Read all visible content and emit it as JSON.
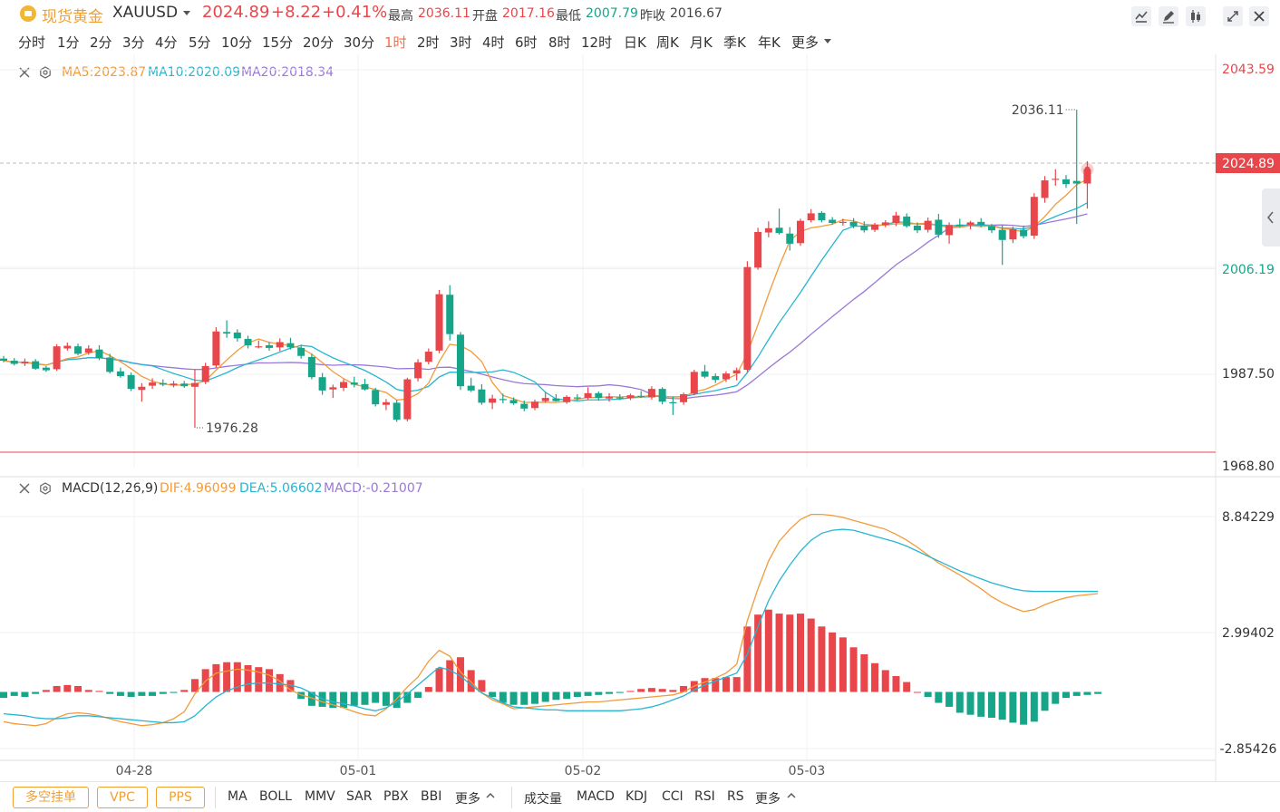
{
  "header": {
    "symbol_name": "现货黄金",
    "symbol_code": "XAUUSD",
    "price": "2024.89",
    "change": "+8.22",
    "change_pct": "+0.41%",
    "stats": [
      {
        "label": "最高",
        "value": "2036.11",
        "color": "#e8464a"
      },
      {
        "label": "开盘",
        "value": "2017.16",
        "color": "#e8464a"
      },
      {
        "label": "最低",
        "value": "2007.79",
        "color": "#17a589"
      },
      {
        "label": "昨收",
        "value": "2016.67",
        "color": "#444444"
      }
    ]
  },
  "toolbar_icons": [
    "indicator-icon",
    "draw-icon",
    "candle-type-icon",
    "fullscreen-icon",
    "close-icon"
  ],
  "intervals": [
    "分时",
    "1分",
    "2分",
    "3分",
    "4分",
    "5分",
    "10分",
    "15分",
    "20分",
    "30分",
    "1时",
    "2时",
    "3时",
    "4时",
    "6时",
    "8时",
    "12时",
    "日K",
    "周K",
    "月K",
    "季K",
    "年K",
    "更多"
  ],
  "active_interval": "1时",
  "ma_legend": {
    "ma5": "MA5:2023.87",
    "ma10": "MA10:2020.09",
    "ma20": "MA20:2018.34"
  },
  "macd_legend": {
    "name": "MACD(12,26,9)",
    "dif": "DIF:4.96099",
    "dea": "DEA:5.06602",
    "macd": "MACD:-0.21007"
  },
  "colors": {
    "up": "#e8464a",
    "down": "#17a589",
    "ma5": "#f39a3a",
    "ma10": "#27b5d1",
    "ma20": "#9a78d8",
    "accent": "#ff6a3d"
  },
  "chart_data": [
    {
      "type": "candlestick",
      "title": "XAUUSD 1时",
      "x_labels": [
        "04-28",
        "05-01",
        "05-02",
        "05-03"
      ],
      "y_ticks": [
        "2043.59",
        "2024.89",
        "2006.19",
        "1987.50",
        "1968.80"
      ],
      "ylim": [
        1968.8,
        2043.59
      ],
      "current_price": 2024.89,
      "high_annotation": "2036.11",
      "low_annotation": "1976.28",
      "grid": true,
      "candles": [
        [
          1989.3,
          1989.8,
          1988.6,
          1988.9
        ],
        [
          1988.9,
          1989.4,
          1988.0,
          1988.3
        ],
        [
          1988.4,
          1989.3,
          1987.9,
          1988.7
        ],
        [
          1988.8,
          1989.2,
          1987.2,
          1987.4
        ],
        [
          1987.6,
          1987.9,
          1986.8,
          1987.1
        ],
        [
          1987.3,
          1992.0,
          1987.0,
          1991.6
        ],
        [
          1991.2,
          1992.3,
          1990.8,
          1991.7
        ],
        [
          1991.6,
          1992.1,
          1989.9,
          1990.2
        ],
        [
          1990.4,
          1991.8,
          1990.0,
          1991.2
        ],
        [
          1991.0,
          1991.8,
          1989.0,
          1989.4
        ],
        [
          1989.5,
          1990.2,
          1986.5,
          1986.8
        ],
        [
          1986.9,
          1987.6,
          1985.7,
          1986.0
        ],
        [
          1986.2,
          1986.7,
          1983.2,
          1983.6
        ],
        [
          1983.4,
          1984.7,
          1981.2,
          1984.0
        ],
        [
          1984.2,
          1985.6,
          1983.6,
          1984.8
        ],
        [
          1984.7,
          1985.4,
          1984.1,
          1984.4
        ],
        [
          1984.3,
          1985.1,
          1983.9,
          1984.6
        ],
        [
          1984.6,
          1985.1,
          1983.8,
          1984.1
        ],
        [
          1984.0,
          1987.3,
          1976.3,
          1984.7
        ],
        [
          1984.9,
          1988.5,
          1984.5,
          1987.9
        ],
        [
          1988.0,
          1995.2,
          1987.6,
          1994.4
        ],
        [
          1994.3,
          1996.5,
          1993.2,
          1994.0
        ],
        [
          1994.2,
          1994.8,
          1992.5,
          1993.1
        ],
        [
          1993.0,
          1993.6,
          1991.2,
          1991.8
        ],
        [
          1991.6,
          1992.7,
          1991.2,
          1991.6
        ],
        [
          1991.8,
          1992.4,
          1990.8,
          1991.3
        ],
        [
          1991.4,
          1993.1,
          1990.7,
          1992.4
        ],
        [
          1992.2,
          1993.2,
          1991.0,
          1991.4
        ],
        [
          1991.3,
          1991.9,
          1989.3,
          1989.8
        ],
        [
          1989.6,
          1990.2,
          1985.4,
          1985.8
        ],
        [
          1985.8,
          1986.6,
          1982.5,
          1983.3
        ],
        [
          1983.5,
          1984.4,
          1981.9,
          1983.9
        ],
        [
          1983.8,
          1985.4,
          1983.2,
          1984.9
        ],
        [
          1984.8,
          1985.9,
          1983.9,
          1984.4
        ],
        [
          1984.5,
          1985.5,
          1983.3,
          1983.5
        ],
        [
          1983.4,
          1983.8,
          1980.3,
          1980.7
        ],
        [
          1980.6,
          1981.7,
          1979.6,
          1981.1
        ],
        [
          1981.0,
          1981.5,
          1977.4,
          1977.8
        ],
        [
          1977.9,
          1985.7,
          1977.5,
          1985.4
        ],
        [
          1985.6,
          1989.2,
          1985.0,
          1988.6
        ],
        [
          1988.7,
          1991.2,
          1988.2,
          1990.6
        ],
        [
          1990.8,
          2002.2,
          1990.3,
          2001.4
        ],
        [
          2001.3,
          2003.1,
          1992.7,
          1993.9
        ],
        [
          1993.8,
          1994.3,
          1983.4,
          1984.1
        ],
        [
          1984.2,
          1985.7,
          1983.0,
          1983.3
        ],
        [
          1983.5,
          1984.5,
          1980.6,
          1981.0
        ],
        [
          1981.0,
          1982.5,
          1979.8,
          1981.8
        ],
        [
          1981.7,
          1982.7,
          1980.9,
          1981.6
        ],
        [
          1981.5,
          1982.0,
          1980.6,
          1980.9
        ],
        [
          1980.8,
          1981.4,
          1979.4,
          1979.9
        ],
        [
          1980.0,
          1981.6,
          1979.6,
          1981.2
        ],
        [
          1981.3,
          1982.9,
          1981.0,
          1981.9
        ],
        [
          1981.8,
          1982.6,
          1981.2,
          1981.3
        ],
        [
          1981.1,
          1982.4,
          1980.8,
          1982.1
        ],
        [
          1982.0,
          1982.6,
          1981.5,
          1981.8
        ],
        [
          1981.9,
          1983.9,
          1981.6,
          1982.8
        ],
        [
          1982.8,
          1983.1,
          1981.4,
          1981.9
        ],
        [
          1981.8,
          1982.8,
          1981.2,
          1982.1
        ],
        [
          1982.0,
          1982.6,
          1981.5,
          1981.8
        ],
        [
          1981.9,
          1982.7,
          1981.5,
          1982.4
        ],
        [
          1982.3,
          1983.2,
          1981.9,
          1982.2
        ],
        [
          1982.0,
          1984.1,
          1981.6,
          1983.6
        ],
        [
          1983.6,
          1983.9,
          1980.7,
          1981.2
        ],
        [
          1981.1,
          1982.2,
          1978.7,
          1981.0
        ],
        [
          1981.1,
          1982.9,
          1980.6,
          1982.6
        ],
        [
          1982.7,
          1987.2,
          1982.4,
          1986.8
        ],
        [
          1986.9,
          1988.1,
          1985.6,
          1985.9
        ],
        [
          1986.0,
          1986.5,
          1984.7,
          1985.3
        ],
        [
          1985.4,
          1986.9,
          1984.9,
          1986.5
        ],
        [
          1986.5,
          1987.6,
          1985.2,
          1987.1
        ],
        [
          1987.2,
          2007.6,
          1986.8,
          2006.5
        ],
        [
          2006.4,
          2013.9,
          2006.0,
          2013.1
        ],
        [
          2013.0,
          2015.1,
          2012.1,
          2013.8
        ],
        [
          2013.9,
          2017.5,
          2012.6,
          2012.9
        ],
        [
          2012.8,
          2014.0,
          2009.6,
          2010.9
        ],
        [
          2011.0,
          2015.6,
          2010.5,
          2015.2
        ],
        [
          2015.3,
          2017.4,
          2014.9,
          2016.6
        ],
        [
          2016.7,
          2017.0,
          2014.9,
          2015.3
        ],
        [
          2015.4,
          2015.9,
          2014.5,
          2014.8
        ],
        [
          2014.8,
          2015.6,
          2014.3,
          2015.0
        ],
        [
          2015.0,
          2015.7,
          2013.8,
          2014.2
        ],
        [
          2014.3,
          2015.1,
          2013.0,
          2013.4
        ],
        [
          2013.5,
          2014.8,
          2013.1,
          2014.5
        ],
        [
          2014.4,
          2015.3,
          2014.0,
          2014.9
        ],
        [
          2014.8,
          2016.9,
          2014.2,
          2016.2
        ],
        [
          2016.0,
          2016.6,
          2013.9,
          2014.2
        ],
        [
          2014.3,
          2014.9,
          2012.9,
          2013.4
        ],
        [
          2013.5,
          2015.8,
          2013.0,
          2015.2
        ],
        [
          2015.4,
          2016.5,
          2012.0,
          2012.6
        ],
        [
          2012.5,
          2014.9,
          2010.9,
          2014.4
        ],
        [
          2014.5,
          2015.6,
          2013.9,
          2014.3
        ],
        [
          2014.4,
          2015.2,
          2013.6,
          2014.9
        ],
        [
          2015.0,
          2015.7,
          2014.0,
          2014.4
        ],
        [
          2014.2,
          2014.6,
          2012.9,
          2013.4
        ],
        [
          2013.5,
          2014.3,
          2006.9,
          2011.6
        ],
        [
          2011.7,
          2014.1,
          2011.0,
          2013.6
        ],
        [
          2013.5,
          2014.3,
          2011.9,
          2012.3
        ],
        [
          2012.4,
          2020.4,
          2011.8,
          2019.7
        ],
        [
          2019.5,
          2023.6,
          2018.6,
          2022.8
        ],
        [
          2022.9,
          2024.9,
          2021.8,
          2023.1
        ],
        [
          2023.0,
          2023.8,
          2021.4,
          2022.1
        ],
        [
          2022.7,
          2036.1,
          2014.6,
          2022.2
        ],
        [
          2022.2,
          2026.4,
          2017.5,
          2024.9
        ]
      ]
    },
    {
      "type": "bar+line",
      "title": "MACD(12,26,9)",
      "y_ticks": [
        "8.84229",
        "2.99402",
        "-2.85426"
      ],
      "ylim": [
        -2.85426,
        8.84229
      ],
      "grid": true,
      "macd_hist": [
        -0.3,
        -0.2,
        -0.25,
        -0.1,
        0.1,
        0.3,
        0.35,
        0.3,
        0.1,
        0.05,
        -0.1,
        -0.2,
        -0.25,
        -0.2,
        -0.2,
        -0.1,
        -0.05,
        0.1,
        0.65,
        1.15,
        1.4,
        1.5,
        1.5,
        1.35,
        1.25,
        1.15,
        0.9,
        0.6,
        -0.35,
        -0.7,
        -0.75,
        -0.8,
        -0.8,
        -0.7,
        -0.65,
        -0.55,
        -0.7,
        -0.8,
        -0.55,
        -0.3,
        0.25,
        1.2,
        1.6,
        1.75,
        1.1,
        0.6,
        -0.25,
        -0.55,
        -0.65,
        -0.65,
        -0.6,
        -0.5,
        -0.4,
        -0.35,
        -0.25,
        -0.2,
        -0.15,
        -0.1,
        -0.05,
        0.05,
        0.15,
        0.2,
        0.15,
        0.1,
        0.3,
        0.55,
        0.7,
        0.7,
        0.75,
        0.75,
        3.3,
        3.9,
        4.15,
        3.95,
        3.9,
        3.95,
        3.7,
        3.3,
        3.0,
        2.75,
        2.25,
        1.9,
        1.45,
        1.1,
        0.8,
        0.5,
        0.0,
        -0.25,
        -0.55,
        -0.75,
        -1.05,
        -1.15,
        -1.25,
        -1.3,
        -1.4,
        -1.55,
        -1.65,
        -1.5,
        -0.95,
        -0.6,
        -0.3,
        -0.2,
        -0.15,
        -0.1
      ],
      "dif": [
        -1.5,
        -1.6,
        -1.65,
        -1.7,
        -1.6,
        -1.3,
        -1.1,
        -1.05,
        -1.1,
        -1.2,
        -1.35,
        -1.5,
        -1.6,
        -1.7,
        -1.65,
        -1.55,
        -1.35,
        -1.0,
        -0.1,
        0.55,
        0.95,
        1.05,
        1.15,
        1.1,
        1.0,
        0.85,
        0.55,
        0.1,
        -0.15,
        -0.3,
        -0.5,
        -0.65,
        -0.8,
        -1.0,
        -1.15,
        -1.2,
        -0.85,
        -0.35,
        0.25,
        0.75,
        1.55,
        2.1,
        1.8,
        1.0,
        0.5,
        -0.05,
        -0.4,
        -0.6,
        -0.85,
        -0.8,
        -0.75,
        -0.7,
        -0.65,
        -0.6,
        -0.55,
        -0.5,
        -0.5,
        -0.45,
        -0.4,
        -0.35,
        -0.3,
        -0.25,
        -0.2,
        -0.15,
        0.0,
        0.3,
        0.5,
        0.7,
        0.95,
        1.4,
        3.6,
        5.2,
        6.6,
        7.6,
        8.2,
        8.7,
        8.95,
        8.95,
        8.9,
        8.8,
        8.65,
        8.5,
        8.35,
        8.2,
        7.95,
        7.65,
        7.3,
        6.9,
        6.5,
        6.2,
        5.9,
        5.55,
        5.2,
        4.8,
        4.5,
        4.25,
        4.05,
        4.15,
        4.4,
        4.6,
        4.75,
        4.85,
        4.9,
        4.96
      ],
      "dea": [
        -1.1,
        -1.15,
        -1.2,
        -1.3,
        -1.35,
        -1.35,
        -1.3,
        -1.2,
        -1.2,
        -1.25,
        -1.3,
        -1.35,
        -1.4,
        -1.45,
        -1.5,
        -1.55,
        -1.55,
        -1.5,
        -1.2,
        -0.7,
        -0.25,
        0.05,
        0.25,
        0.4,
        0.45,
        0.45,
        0.4,
        0.35,
        0.2,
        -0.05,
        -0.35,
        -0.5,
        -0.6,
        -0.7,
        -0.85,
        -0.95,
        -0.8,
        -0.5,
        -0.1,
        0.35,
        0.8,
        1.25,
        1.1,
        0.8,
        0.35,
        -0.05,
        -0.3,
        -0.55,
        -0.75,
        -0.8,
        -0.85,
        -0.9,
        -0.9,
        -0.95,
        -0.95,
        -0.95,
        -0.95,
        -0.95,
        -0.95,
        -0.9,
        -0.85,
        -0.75,
        -0.6,
        -0.4,
        -0.2,
        0.1,
        0.35,
        0.55,
        0.75,
        0.95,
        1.9,
        3.3,
        4.6,
        5.6,
        6.4,
        7.1,
        7.65,
        8.0,
        8.15,
        8.2,
        8.15,
        8.0,
        7.85,
        7.7,
        7.55,
        7.35,
        7.1,
        6.85,
        6.6,
        6.35,
        6.1,
        5.9,
        5.7,
        5.5,
        5.35,
        5.2,
        5.1,
        5.07,
        5.07,
        5.07,
        5.07,
        5.07,
        5.07,
        5.07
      ]
    }
  ],
  "bottombar": {
    "boxed": [
      "多空挂单",
      "VPC",
      "PPS"
    ],
    "main_indicators": [
      "MA",
      "BOLL",
      "MMV",
      "SAR",
      "PBX",
      "BBI",
      "更多"
    ],
    "sub_indicators": [
      "成交量",
      "MACD",
      "KDJ",
      "CCI",
      "RSI",
      "RS",
      "更多"
    ]
  }
}
